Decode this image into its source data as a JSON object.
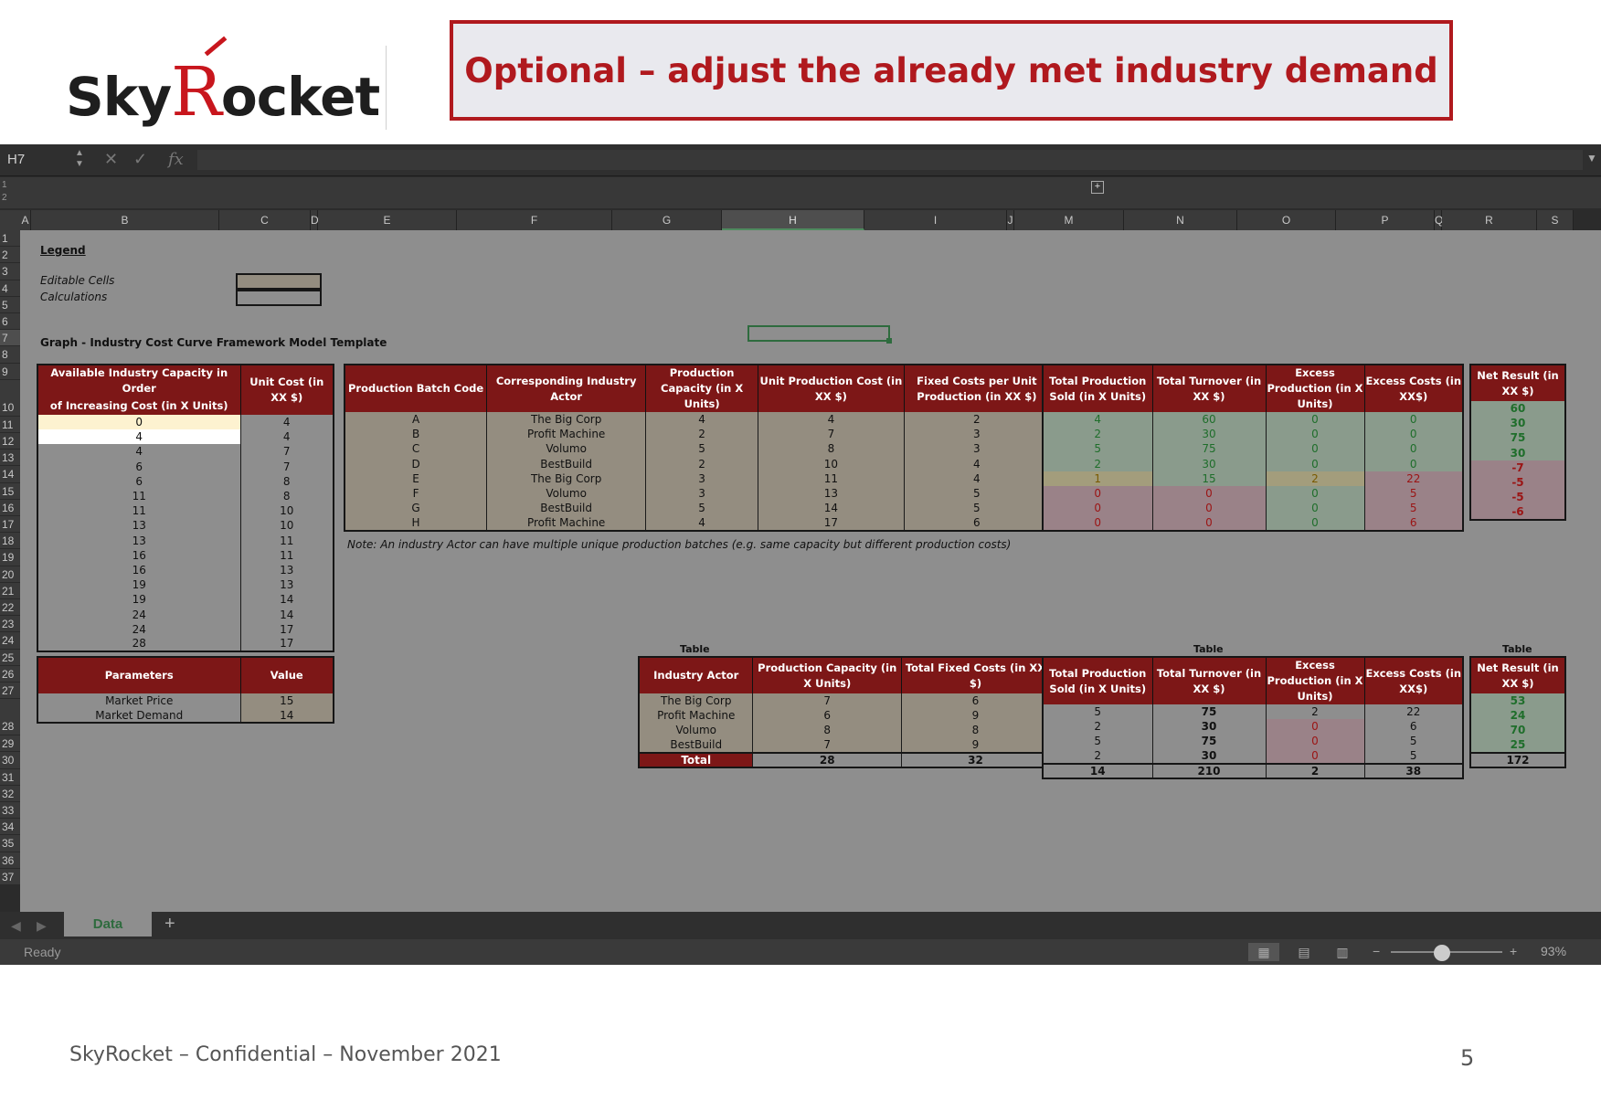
{
  "slide": {
    "logo_text_1": "Sky",
    "logo_text_r": "R",
    "logo_text_2": "ocket",
    "title": "Optional – adjust the already met industry demand",
    "footer": "SkyRocket – Confidential – November 2021",
    "page_number": "5",
    "brand_color": "#b0191e"
  },
  "formula_bar": {
    "name_box": "H7",
    "cancel_icon": "✕",
    "enter_icon": "✓",
    "fx": "fx",
    "value": ""
  },
  "outline": {
    "levels": [
      "1",
      "2"
    ],
    "expand": "+"
  },
  "columns": [
    "A",
    "B",
    "C",
    "D",
    "E",
    "F",
    "G",
    "H",
    "I",
    "J",
    "M",
    "N",
    "O",
    "P",
    "Q",
    "R",
    "S"
  ],
  "rows": [
    "1",
    "2",
    "3",
    "4",
    "5",
    "6",
    "7",
    "8",
    "9",
    "10",
    "11",
    "12",
    "13",
    "14",
    "15",
    "16",
    "17",
    "18",
    "19",
    "20",
    "21",
    "22",
    "23",
    "24",
    "25",
    "26",
    "27",
    "28",
    "29",
    "30",
    "31",
    "32",
    "33",
    "34",
    "35",
    "36",
    "37"
  ],
  "legend": {
    "title": "Legend",
    "editable": "Editable Cells",
    "calculations": "Calculations",
    "graph_title": "Graph - Industry Cost Curve Framework Model Template"
  },
  "capacity_table": {
    "headers": [
      "Available Industry Capacity in Order of Increasing Cost (in X Units)",
      "Unit Cost (in XX $)"
    ],
    "header_line1": "Available Industry Capacity in Order",
    "header_line2": "of Increasing Cost (in X Units)",
    "rows": [
      [
        "0",
        "4"
      ],
      [
        "4",
        "4"
      ],
      [
        "4",
        "7"
      ],
      [
        "6",
        "7"
      ],
      [
        "6",
        "8"
      ],
      [
        "11",
        "8"
      ],
      [
        "11",
        "10"
      ],
      [
        "13",
        "10"
      ],
      [
        "13",
        "11"
      ],
      [
        "16",
        "11"
      ],
      [
        "16",
        "13"
      ],
      [
        "19",
        "13"
      ],
      [
        "19",
        "14"
      ],
      [
        "24",
        "14"
      ],
      [
        "24",
        "17"
      ],
      [
        "28",
        "17"
      ]
    ]
  },
  "parameters": {
    "headers": [
      "Parameters",
      "Value"
    ],
    "rows": [
      [
        "Market Price",
        "15"
      ],
      [
        "Market Demand",
        "14"
      ]
    ]
  },
  "batch_table": {
    "headers": [
      "Production Batch Code",
      "Corresponding Industry Actor",
      "Production Capacity (in X Units)",
      "Unit Production Cost (in XX $)",
      "Fixed Costs per Unit Production (in XX $)"
    ],
    "rows": [
      [
        "A",
        "The Big Corp",
        "4",
        "4",
        "2"
      ],
      [
        "B",
        "Profit Machine",
        "2",
        "7",
        "3"
      ],
      [
        "C",
        "Volumo",
        "5",
        "8",
        "3"
      ],
      [
        "D",
        "BestBuild",
        "2",
        "10",
        "4"
      ],
      [
        "E",
        "The Big Corp",
        "3",
        "11",
        "4"
      ],
      [
        "F",
        "Volumo",
        "3",
        "13",
        "5"
      ],
      [
        "G",
        "BestBuild",
        "5",
        "14",
        "5"
      ],
      [
        "H",
        "Profit Machine",
        "4",
        "17",
        "6"
      ]
    ]
  },
  "result_table": {
    "headers": [
      "Total Production Sold (in X Units)",
      "Total Turnover (in XX $)",
      "Excess Production (in X Units)",
      "Excess Costs (in XX$)"
    ],
    "rows": [
      [
        "4",
        "60",
        "0",
        "0"
      ],
      [
        "2",
        "30",
        "0",
        "0"
      ],
      [
        "5",
        "75",
        "0",
        "0"
      ],
      [
        "2",
        "30",
        "0",
        "0"
      ],
      [
        "1",
        "15",
        "2",
        "22"
      ],
      [
        "0",
        "0",
        "0",
        "5"
      ],
      [
        "0",
        "0",
        "0",
        "5"
      ],
      [
        "0",
        "0",
        "0",
        "6"
      ]
    ]
  },
  "net_table": {
    "headers": [
      "Net Result (in XX $)"
    ],
    "rows": [
      "60",
      "30",
      "75",
      "30",
      "-7",
      "-5",
      "-5",
      "-6"
    ]
  },
  "note": "Note: An industry Actor can have multiple unique production batches (e.g. same capacity but different production costs)",
  "summary": {
    "label": "Table",
    "actor_table": {
      "headers": [
        "Industry Actor",
        "Production Capacity (in X Units)",
        "Total Fixed Costs (in XX $)"
      ],
      "rows": [
        [
          "The Big Corp",
          "7",
          "6"
        ],
        [
          "Profit Machine",
          "6",
          "9"
        ],
        [
          "Volumo",
          "8",
          "8"
        ],
        [
          "BestBuild",
          "7",
          "9"
        ]
      ],
      "total": [
        "Total",
        "28",
        "32"
      ]
    },
    "result_table": {
      "headers": [
        "Total Production Sold (in X Units)",
        "Total Turnover (in XX $)",
        "Excess Production (in X Units)",
        "Excess Costs (in XX$)"
      ],
      "rows": [
        [
          "5",
          "75",
          "2",
          "22"
        ],
        [
          "2",
          "30",
          "0",
          "6"
        ],
        [
          "5",
          "75",
          "0",
          "5"
        ],
        [
          "2",
          "30",
          "0",
          "5"
        ]
      ],
      "total": [
        "14",
        "210",
        "2",
        "38"
      ]
    },
    "net_table": {
      "headers": [
        "Net Result (in XX $)"
      ],
      "rows": [
        "53",
        "24",
        "70",
        "25"
      ],
      "total": "172"
    }
  },
  "sheet_tabs": {
    "active": "Data",
    "add": "+"
  },
  "status_bar": {
    "status": "Ready",
    "zoom": "93%",
    "zoom_level": 0.93
  },
  "colors": {
    "header_red": "#7d1717",
    "editable_tan": "#948d80",
    "positive_green": "#1f6e2b",
    "negative_red": "#9b1414",
    "selection_green": "#2e6b3e"
  }
}
